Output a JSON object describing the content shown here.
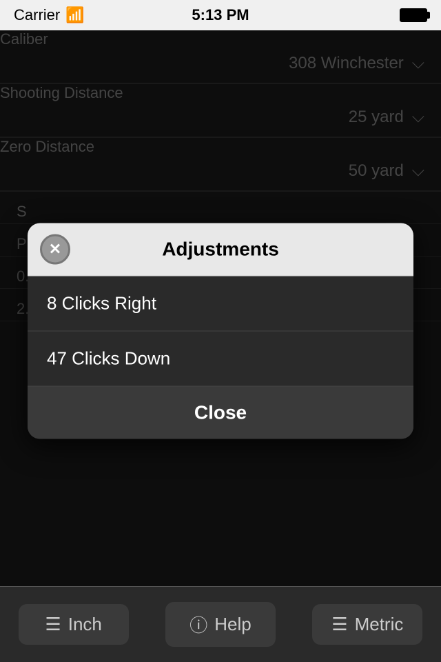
{
  "statusBar": {
    "carrier": "Carrier",
    "wifi": "📶",
    "time": "5:13 PM",
    "battery": "full"
  },
  "background": {
    "caliber": {
      "label": "Caliber",
      "value": "308 Winchester"
    },
    "shootingDistance": {
      "label": "Shooting Distance",
      "value": "25 yard"
    },
    "zeroDistance": {
      "label": "Zero Distance",
      "value": "50 yard"
    },
    "shortLabels": [
      "S",
      "P",
      "0.",
      "2."
    ]
  },
  "modal": {
    "title": "Adjustments",
    "closeButtonLabel": "✕",
    "items": [
      {
        "text": "8 Clicks Right"
      },
      {
        "text": "47 Clicks Down"
      }
    ],
    "closeLabel": "Close"
  },
  "tabBar": {
    "tabs": [
      {
        "label": "Inch",
        "icon": "≡"
      },
      {
        "label": "Help",
        "icon": "ℹ"
      },
      {
        "label": "Metric",
        "icon": "≡"
      }
    ]
  }
}
